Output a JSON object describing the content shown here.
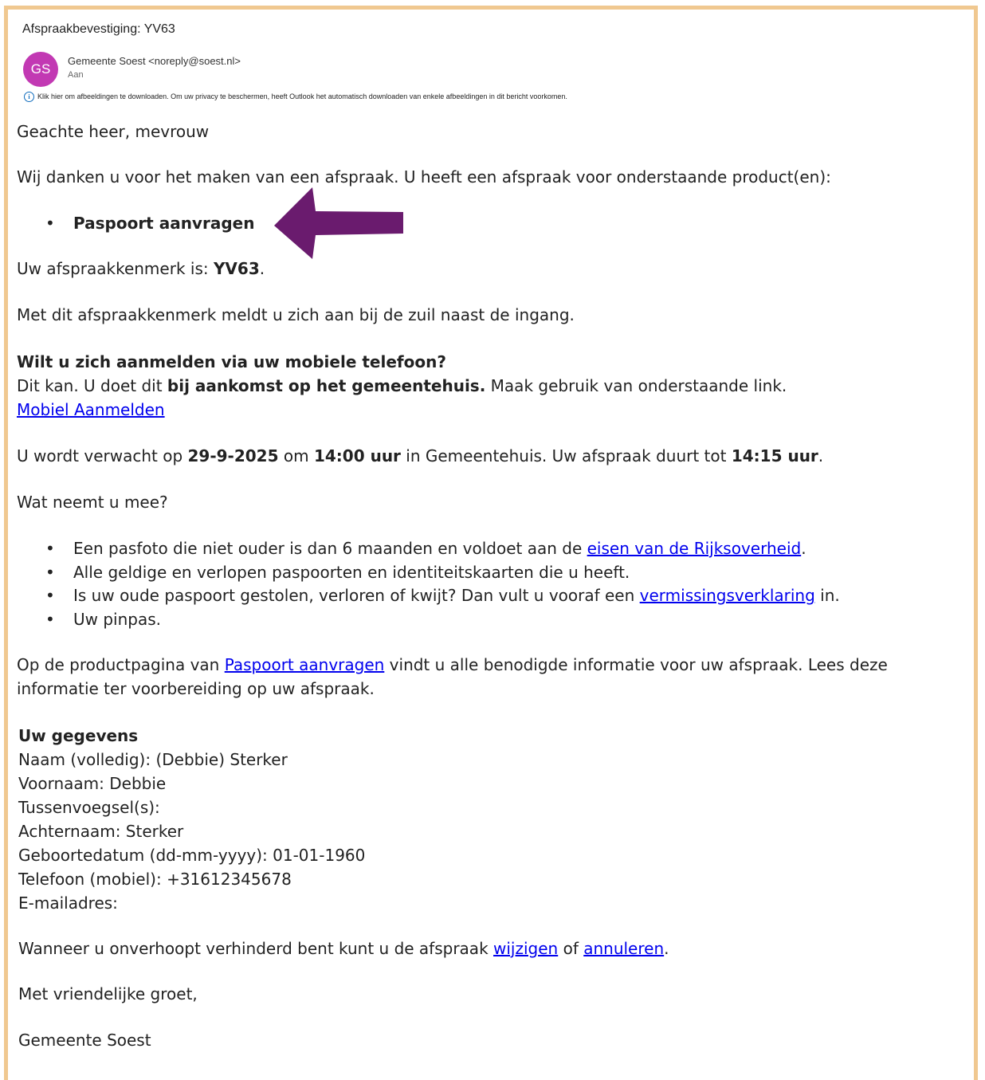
{
  "email": {
    "subject": "Afspraakbevestiging: YV63",
    "avatar_initials": "GS",
    "avatar_color": "#c239b3",
    "sender": "Gemeente Soest <noreply@soest.nl>",
    "to_label": "Aan",
    "info_banner": "Klik hier om afbeeldingen te downloaden. Om uw privacy te beschermen, heeft Outlook het automatisch downloaden van enkele afbeeldingen in dit bericht voorkomen."
  },
  "body": {
    "greeting": "Geachte heer, mevrouw",
    "thanks": "Wij danken u voor het maken van een afspraak. U heeft een afspraak voor onderstaande product(en):",
    "product": "Paspoort aanvragen",
    "reference_prefix": "Uw afspraakkenmerk is: ",
    "reference_code": "YV63",
    "reference_suffix": ".",
    "checkin_info": "Met dit afspraakkenmerk meldt u zich aan bij de zuil naast de ingang.",
    "mobile_heading": "Wilt u zich aanmelden via uw mobiele telefoon?",
    "mobile_text_1": "Dit kan. U doet dit ",
    "mobile_text_bold": "bij aankomst op het gemeentehuis.",
    "mobile_text_2": " Maak gebruik van onderstaande link.",
    "mobile_link": "Mobiel Aanmelden",
    "expected_1": "U wordt verwacht op ",
    "expected_date": "29-9-2025",
    "expected_2": " om ",
    "expected_time": "14:00 uur",
    "expected_3": " in Gemeentehuis. Uw afspraak duurt tot ",
    "expected_end": "14:15 uur",
    "expected_4": ".",
    "bring_heading": "Wat neemt u mee?",
    "bring_1_pre": "Een pasfoto die niet ouder is dan 6 maanden en voldoet aan de ",
    "bring_1_link": "eisen van de Rijksoverheid",
    "bring_1_post": ".",
    "bring_2": "Alle geldige en verlopen paspoorten en identiteitskaarten die u heeft.",
    "bring_3_pre": "Is uw oude paspoort gestolen, verloren of kwijt? Dan vult u vooraf een ",
    "bring_3_link": "vermissingsverklaring",
    "bring_3_post": " in.",
    "bring_4": "Uw pinpas.",
    "product_page_pre": "Op de productpagina van ",
    "product_page_link": "Paspoort aanvragen",
    "product_page_post": " vindt u alle benodigde informatie voor uw afspraak. Lees deze",
    "product_page_line2": "informatie ter voorbereiding op uw afspraak.",
    "details_heading": "Uw gegevens",
    "details_name": "Naam (volledig): (Debbie) Sterker",
    "details_firstname": "Voornaam: Debbie",
    "details_infix": "Tussenvoegsel(s):",
    "details_lastname": "Achternaam: Sterker",
    "details_dob": "Geboortedatum (dd-mm-yyyy): 01-01-1960",
    "details_phone": "Telefoon (mobiel): +31612345678",
    "details_email": "E-mailadres:",
    "change_pre": "Wanneer u onverhoopt verhinderd bent kunt u de afspraak ",
    "change_link": "wijzigen",
    "change_mid": " of ",
    "cancel_link": "annuleren",
    "change_post": ".",
    "closing": "Met vriendelijke groet,",
    "signature": "Gemeente Soest"
  },
  "colors": {
    "frame_border": "#f0c890",
    "arrow": "#6a1b6e",
    "link": "#0000ee"
  }
}
